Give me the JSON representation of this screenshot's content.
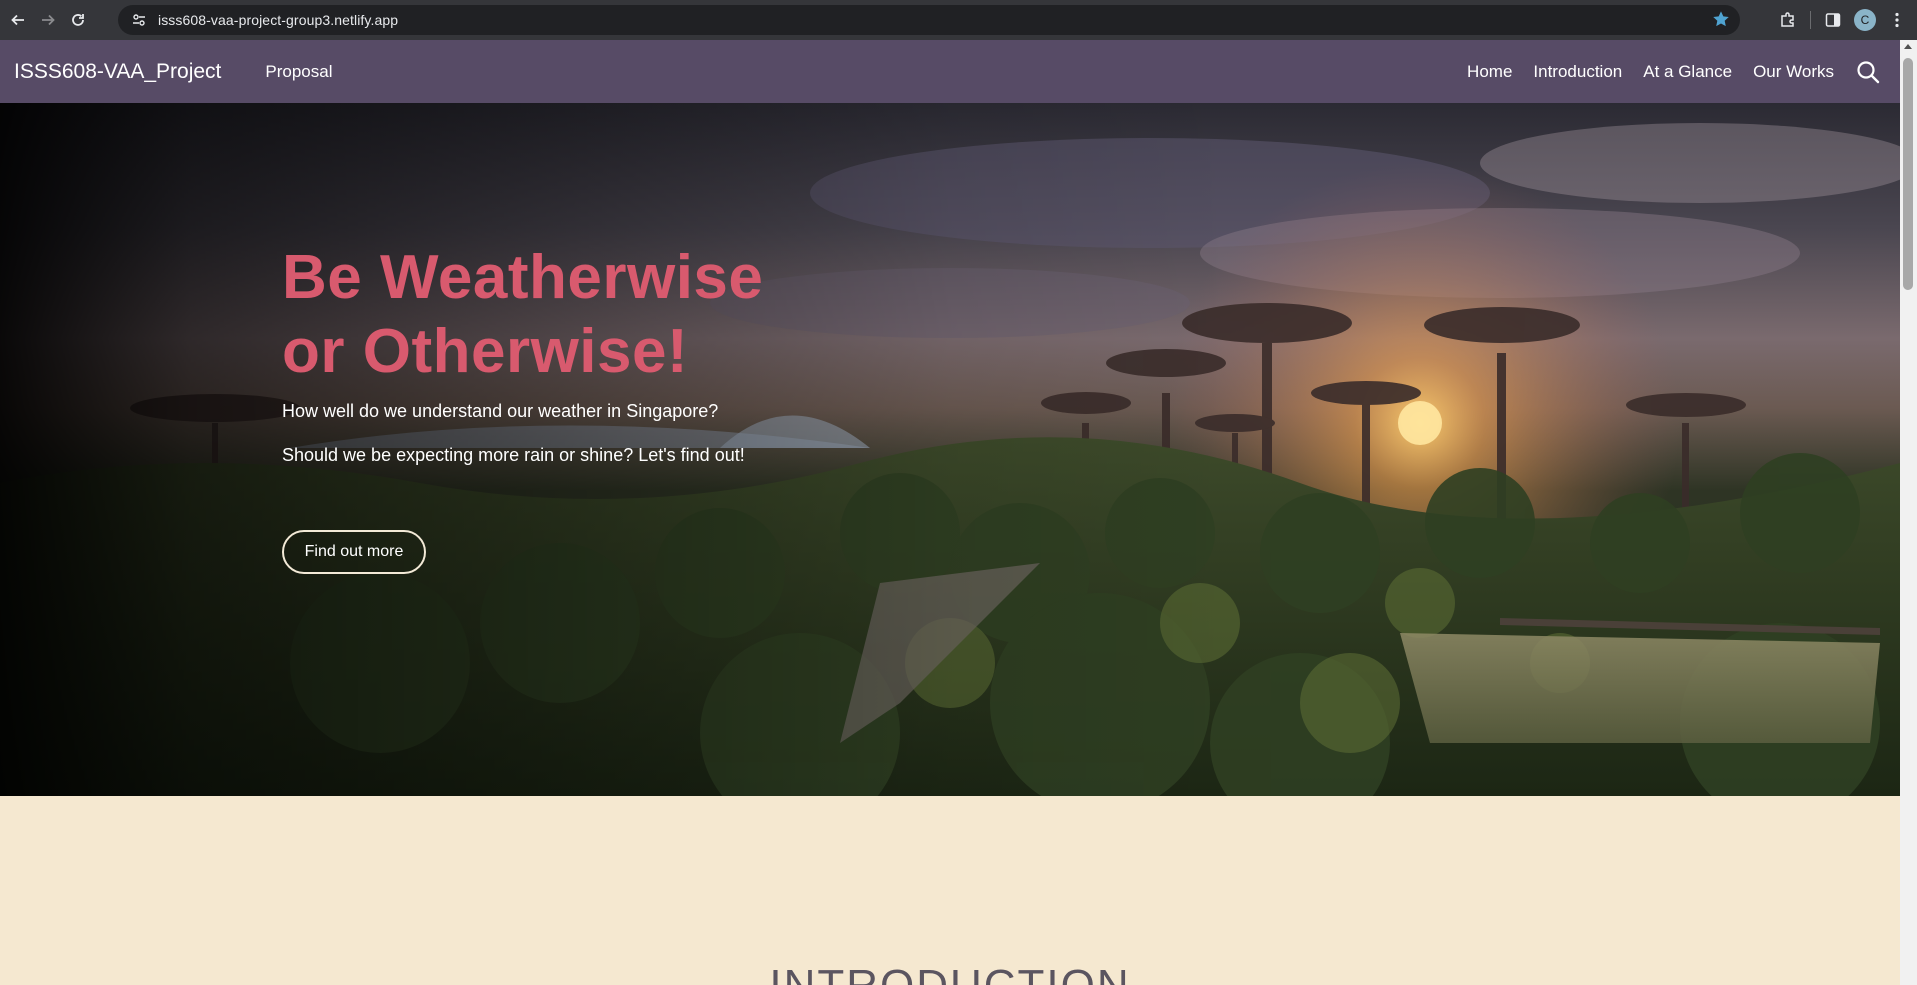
{
  "browser": {
    "url": "isss608-vaa-project-group3.netlify.app",
    "profile_initial": "C",
    "icons": [
      "back-icon",
      "forward-icon",
      "reload-icon",
      "site-info-icon",
      "bookmark-star-icon",
      "extensions-icon",
      "side-panel-icon",
      "menu-icon"
    ]
  },
  "navbar": {
    "brand": "ISSS608-VAA_Project",
    "left_link": "Proposal",
    "links": [
      "Home",
      "Introduction",
      "At a Glance",
      "Our Works"
    ],
    "search_icon": "search-icon",
    "background": "#574b66"
  },
  "hero": {
    "title_line1": "Be Weatherwise",
    "title_line2": "or Otherwise!",
    "subtitle1": "How well do we understand our weather in Singapore?",
    "subtitle2": "Should we be expecting more rain or shine? Let's find out!",
    "button": "Find out more",
    "title_color": "#d85a6e"
  },
  "intro": {
    "heading": "INTRODUCTION",
    "background": "#f5e8d0"
  }
}
